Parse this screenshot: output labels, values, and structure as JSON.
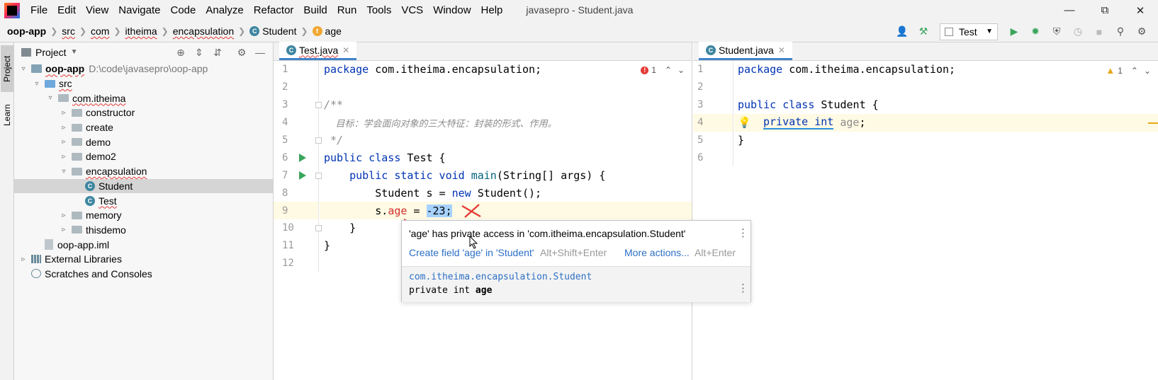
{
  "window": {
    "title": "javasepro - Student.java",
    "menu": [
      "File",
      "Edit",
      "View",
      "Navigate",
      "Code",
      "Analyze",
      "Refactor",
      "Build",
      "Run",
      "Tools",
      "VCS",
      "Window",
      "Help"
    ]
  },
  "breadcrumbs": [
    "oop-app",
    "src",
    "com",
    "itheima",
    "encapsulation",
    "Student",
    "age"
  ],
  "toolbar": {
    "run_config": "Test"
  },
  "left_stripe": {
    "project_tab": "Project",
    "learn_tab": "Learn"
  },
  "project_panel": {
    "title": "Project",
    "tree": [
      {
        "label": "oop-app",
        "path": "D:\\code\\javasepro\\oop-app",
        "level": 0,
        "expanded": true,
        "kind": "module"
      },
      {
        "label": "src",
        "level": 1,
        "expanded": true,
        "kind": "src"
      },
      {
        "label": "com.itheima",
        "level": 2,
        "expanded": true,
        "kind": "package"
      },
      {
        "label": "constructor",
        "level": 3,
        "expanded": false,
        "kind": "package"
      },
      {
        "label": "create",
        "level": 3,
        "expanded": false,
        "kind": "package"
      },
      {
        "label": "demo",
        "level": 3,
        "expanded": false,
        "kind": "package"
      },
      {
        "label": "demo2",
        "level": 3,
        "expanded": false,
        "kind": "package"
      },
      {
        "label": "encapsulation",
        "level": 3,
        "expanded": true,
        "kind": "package"
      },
      {
        "label": "Student",
        "level": 4,
        "kind": "class",
        "selected": true
      },
      {
        "label": "Test",
        "level": 4,
        "kind": "class"
      },
      {
        "label": "memory",
        "level": 3,
        "expanded": false,
        "kind": "package"
      },
      {
        "label": "thisdemo",
        "level": 3,
        "expanded": false,
        "kind": "package"
      },
      {
        "label": "oop-app.iml",
        "level": 1,
        "kind": "iml"
      },
      {
        "label": "External Libraries",
        "level": 0,
        "expanded": false,
        "kind": "lib"
      },
      {
        "label": "Scratches and Consoles",
        "level": 0,
        "kind": "scratch"
      }
    ]
  },
  "editor_left": {
    "tab": "Test.java",
    "inspection_count": "1",
    "line_numbers": [
      "1",
      "2",
      "3",
      "4",
      "5",
      "6",
      "7",
      "8",
      "9",
      "10",
      "11",
      "12"
    ],
    "lines": {
      "l1_kw": "package",
      "l1_rest": " com.itheima.encapsulation;",
      "l3": "/**",
      "l4": "    目标：学会面向对象的三大特征：封装的形式、作用。",
      "l5": " */",
      "l6_kw": "public class",
      "l6_rest": " Test {",
      "l7_kw": "    public static void",
      "l7_fn": " main",
      "l7_rest": "(String[] args) {",
      "l8_a": "        Student s = ",
      "l8_kw": "new",
      "l8_b": " Student();",
      "l9_a": "        s.",
      "l9_err": "age",
      "l9_b": " = ",
      "l9_sel": "-23;",
      "l10": "    }",
      "l11": "}"
    }
  },
  "editor_right": {
    "tab": "Student.java",
    "warning_count": "1",
    "line_numbers": [
      "1",
      "2",
      "3",
      "4",
      "5",
      "6"
    ],
    "lines": {
      "l1_kw": "package",
      "l1_rest": " com.itheima.encapsulation;",
      "l3_kw": "public class",
      "l3_rest": " Student {",
      "l4_kw": "private int",
      "l4_fld": " age",
      "l4_rest": ";",
      "l5": "}"
    }
  },
  "popup": {
    "message": "'age' has private access in 'com.itheima.encapsulation.Student'",
    "action1": "Create field 'age' in 'Student'",
    "shortcut1": "Alt+Shift+Enter",
    "action2": "More actions...",
    "shortcut2": "Alt+Enter",
    "doc_package": "com.itheima.encapsulation.Student",
    "doc_decl_prefix": "private int ",
    "doc_decl_name": "age"
  },
  "colors": {
    "keyword": "#0033b3",
    "error": "#d32f2f",
    "link": "#2c6fc4",
    "selection": "#a6d2ff",
    "current_line": "#fffae3",
    "tab_underline": "#4083c9"
  }
}
